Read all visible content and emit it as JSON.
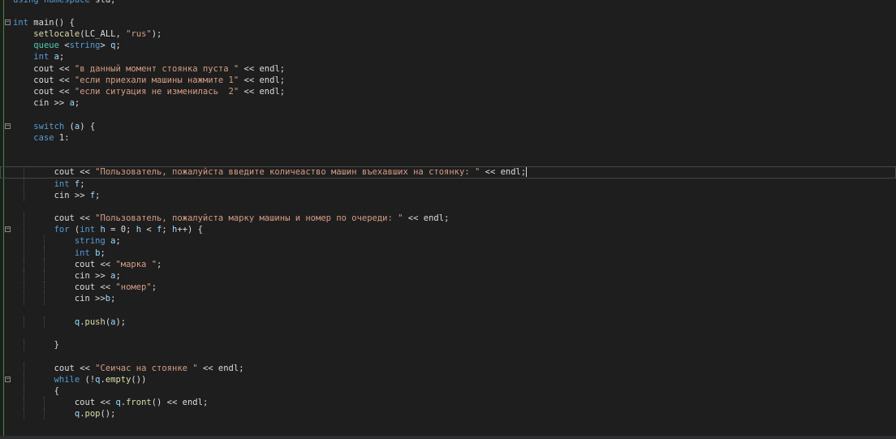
{
  "editor": {
    "lines": [
      {
        "t": "using namespace std;"
      },
      {
        "t": ""
      },
      {
        "t": "int main() {",
        "fold": true
      },
      {
        "t": "    setlocale(LC_ALL, \"rus\");"
      },
      {
        "t": "    queue <string> q;"
      },
      {
        "t": "    int a;"
      },
      {
        "t": "    cout << \"в данный момент стоянка пуста \" << endl;"
      },
      {
        "t": "    cout << \"если приехали машины нажмите 1\" << endl;"
      },
      {
        "t": "    cout << \"если ситуация не изменилась  2\" << endl;"
      },
      {
        "t": "    cin >> a;"
      },
      {
        "t": ""
      },
      {
        "t": "    switch (a) {",
        "fold": true
      },
      {
        "t": "    case 1:"
      },
      {
        "t": ""
      },
      {
        "t": ""
      },
      {
        "t": "        cout << \"Пользователь, пожалуйста введите количеаство машин въехавших на стоянку: \" << endl;",
        "current": true
      },
      {
        "t": "        int f;"
      },
      {
        "t": "        cin >> f;"
      },
      {
        "t": ""
      },
      {
        "t": "        cout << \"Пользователь, пожалуйста марку машины и номер по очереди: \" << endl;"
      },
      {
        "t": "        for (int h = 0; h < f; h++) {",
        "fold": true
      },
      {
        "t": "            string a;"
      },
      {
        "t": "            int b;"
      },
      {
        "t": "            cout << \"марка \";"
      },
      {
        "t": "            cin >> a;"
      },
      {
        "t": "            cout << \"номер\";"
      },
      {
        "t": "            cin >>b;"
      },
      {
        "t": ""
      },
      {
        "t": "            q.push(a);"
      },
      {
        "t": ""
      },
      {
        "t": "        }"
      },
      {
        "t": ""
      },
      {
        "t": "        cout << \"Сеичас на стоянке \" << endl;"
      },
      {
        "t": "        while (!q.empty())",
        "fold": true
      },
      {
        "t": "        {"
      },
      {
        "t": "            cout << q.front() << endl;"
      },
      {
        "t": "            q.pop();"
      },
      {
        "t": ""
      }
    ]
  },
  "colors": {
    "background": "#1e1e1e",
    "keyword": "#569cd6",
    "string": "#d69d85",
    "type": "#4ec9b0",
    "function": "#dcdcaa",
    "variable": "#9cdcfe",
    "text": "#dcdcdc"
  }
}
